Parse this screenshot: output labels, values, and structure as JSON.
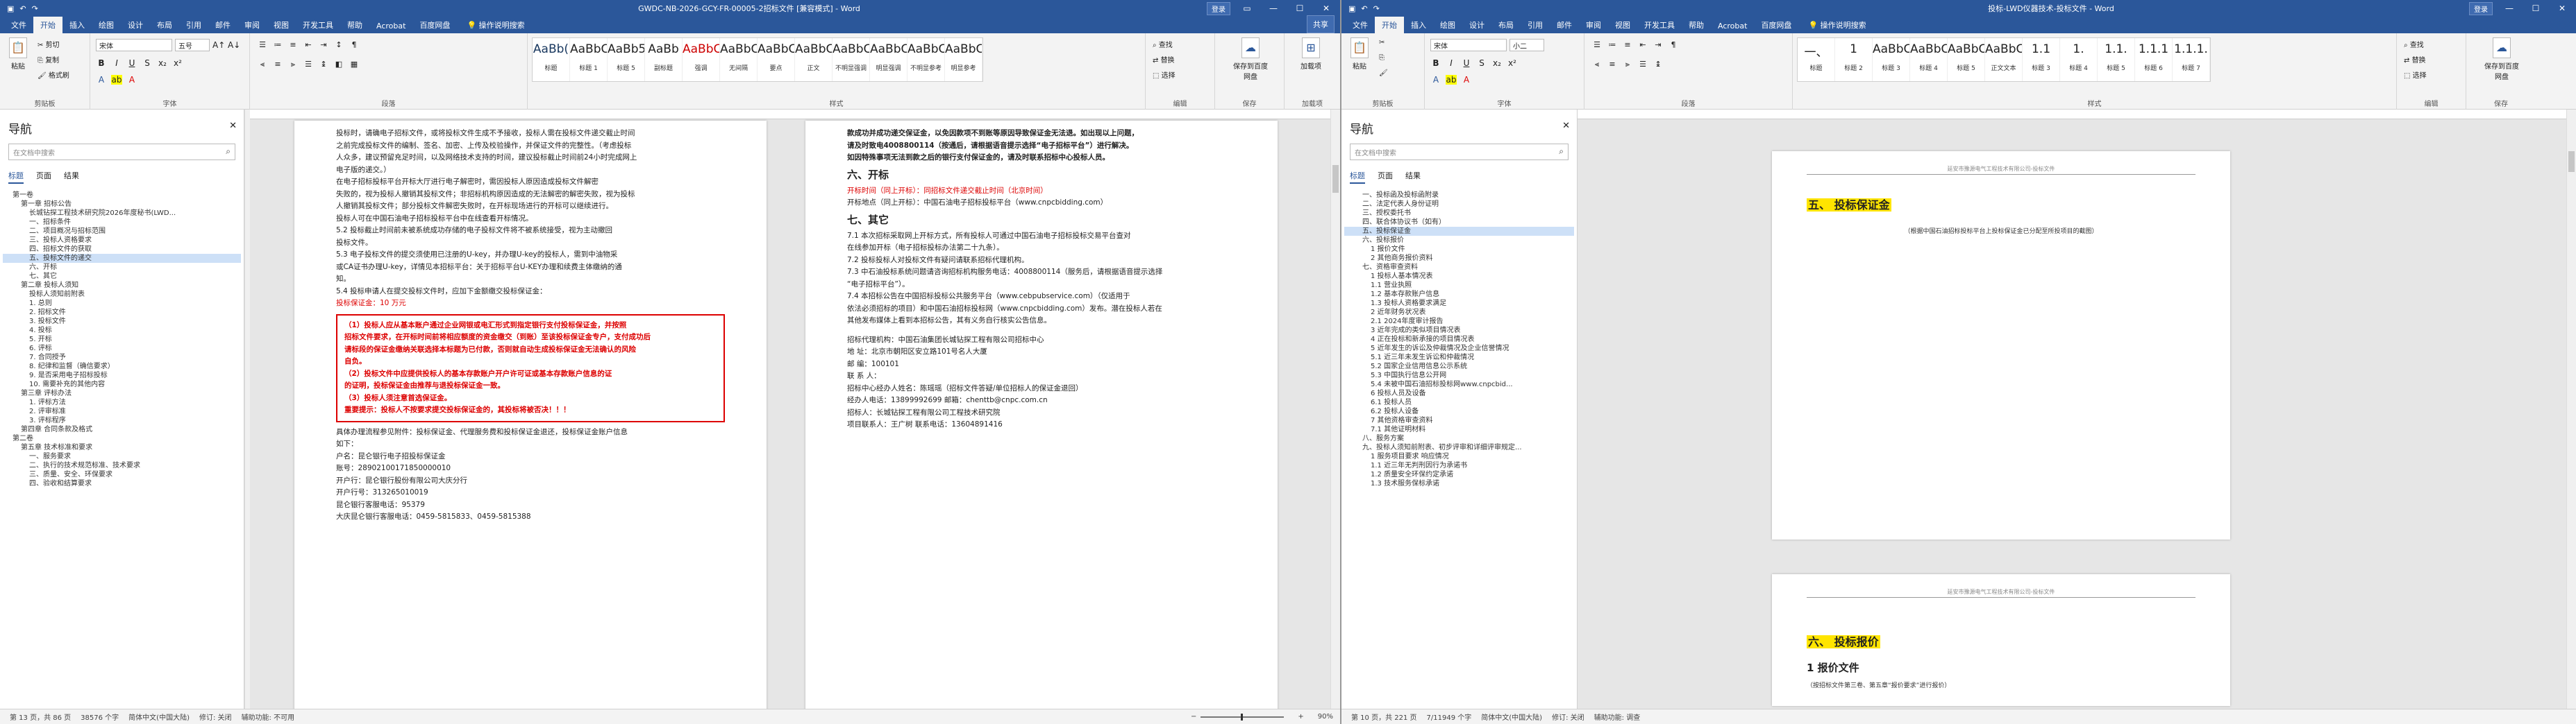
{
  "w1": {
    "title": "GWDC-NB-2026-GCY-FR-00005-2招标文件 [兼容模式] - Word",
    "title_buttons": {
      "login": "登录",
      "share": "共享"
    },
    "qat": [
      "保存",
      "撤销",
      "恢复"
    ],
    "tabs": [
      "文件",
      "开始",
      "插入",
      "绘图",
      "设计",
      "布局",
      "引用",
      "邮件",
      "审阅",
      "视图",
      "开发工具",
      "帮助",
      "Acrobat",
      "百度网盘"
    ],
    "tell_me": "操作说明搜索",
    "ribbon": {
      "clipboard": {
        "label": "剪贴板",
        "paste": "粘贴",
        "cut": "剪切",
        "copy": "复制",
        "painter": "格式刷"
      },
      "font": {
        "label": "字体",
        "name": "宋体",
        "size": "五号"
      },
      "paragraph": {
        "label": "段落"
      },
      "styles": {
        "label": "样式",
        "items": [
          {
            "p": "AaBb(",
            "n": "标题"
          },
          {
            "p": "AaBbCcI",
            "n": "标题 1"
          },
          {
            "p": "AaBb5",
            "n": "标题 5"
          },
          {
            "p": "AaBb",
            "n": "副标题"
          },
          {
            "p": "AaBbCcDd",
            "n": "强调"
          },
          {
            "p": "AaBbCcDd",
            "n": "无间隔"
          },
          {
            "p": "AaBbCcDd",
            "n": "要点"
          },
          {
            "p": "AaBbCcDc",
            "n": "正文"
          },
          {
            "p": "AaBbCcDd",
            "n": "不明显强调"
          },
          {
            "p": "AaBbCcDd",
            "n": "明显强调"
          },
          {
            "p": "AaBbCcDd",
            "n": "不明显参考"
          },
          {
            "p": "AaBbCcDd",
            "n": "明显参考"
          }
        ]
      },
      "editing": {
        "label": "编辑",
        "find": "查找",
        "replace": "替换",
        "select": "选择"
      },
      "save_baidu": {
        "label": "保存",
        "text": "保存到百度网盘"
      },
      "addin": {
        "label": "加载项",
        "text": "加载项"
      }
    },
    "nav": {
      "title": "导航",
      "search_placeholder": "在文档中搜索",
      "tabs": [
        "标题",
        "页面",
        "结果"
      ],
      "items": [
        "第一卷",
        "第一章  招标公告",
        "长城钻探工程技术研究院2026年度秘书(LWD...",
        "一、招标条件",
        "二、项目概况与招标范围",
        "三、投标人资格要求",
        "四、招标文件的获取",
        "五、投标文件的递交",
        "六、开标",
        "七、其它",
        "第二章  投标人须知",
        "投标人须知前附表",
        "1. 总则",
        "2. 招标文件",
        "3. 投标文件",
        "4. 投标",
        "5. 开标",
        "6. 评标",
        "7. 合同授予",
        "8. 纪律和监督（确信要求）",
        "9. 是否采用电子招标投标",
        "10. 需要补充的其他内容",
        "第三章  评标办法",
        "1. 评标方法",
        "2. 评审标准",
        "3. 评标程序",
        "第四章  合同条款及格式",
        "第二卷",
        "第五章  技术标准和要求",
        "一、服务要求",
        "二、执行的技术规范标准、技术要求",
        "三、质量、安全、环保要求",
        "四、验收和结算要求"
      ],
      "highlight_index": 7
    },
    "page_left": {
      "lines": [
        "投标时，请确电子招标文件，或将投标文件生成不予接收，投标人需在投标文件递交截止时间",
        "之前完成投标文件的编制、签名、加密、上传及校验操作，并保证文件的完整性。（考虑投标",
        "人众多，建议预留充足时间，以及网络技术支持的时间，建议投标截止时间前24小时完成网上",
        "电子版的递交。）",
        "    在电子招标投标平台开标大厅进行电子解密时，需因投标人原因造成投标文件解密",
        "失败的，视为投标人撤销其投标文件；非招标机构原因造成的无法解密的解密失败，视为投标",
        "人撤销其投标文件；部分投标文件解密失败时，在开标现场进行的开标可以继续进行。",
        "    投标人可在中国石油电子招标投标平台中在线查看开标情况。",
        "    5.2 投标截止时间前未被系统成功存储的电子投标文件将不被系统接受，视为主动撤回",
        "投标文件。",
        "    5.3 电子投标文件的提交须使用已注册的U-key，并办理U-key的投标人，需到中油物采",
        "或CA证书办理U-key，详情见本招标平台：关于招标平台U-KEY办理和续费主体缴纳的通",
        "知。",
        "    5.4 投标申请人在提交投标文件时，应加下金额缴交投标保证金：",
        "    投标保证金：10 万元"
      ],
      "redbox": [
        "（1）投标人应从基本账户通过企业网银或电汇形式到指定银行支付投标保证金，并按照",
        "招标文件要求，在开标时间前将相应额度的资金缴交（到账）至该投标保证金专户，支付成功后",
        "请标段的保证金缴纳关联选择本标题为已付款，否则就自动生成投标保证金无法确认的风险",
        "自负。",
        "（2）投标文件中应提供投标人的基本存款账户开户许可证或基本存款账户信息的证",
        "的证明，投标保证金由推荐与退投标保证金一致。",
        "（3）投标人须注意首选保证金。",
        "重要提示：投标人不按要求提交投标保证金的，其投标将被否决！！！"
      ],
      "after": [
        "具体办理流程参见附件：投标保证金、代理服务费和投标保证金退还，投标保证金账户信息",
        "如下：",
        "    户名：昆仑银行电子招投标保证金",
        "    账号：28902100171850000010",
        "    开户行：昆仑银行股份有限公司大庆分行",
        "    开户行号：313265010019",
        "    昆仑银行客服电话：95379",
        "    大庆昆仑银行客服电话：0459-5815833、0459-5815388"
      ]
    },
    "page_right": {
      "top": [
        "款成功并成功递交保证金，以免因款项不到账等原因导致保证金无法退。如出现以上问题，",
        "请及时致电4008800114（按通后，请根据语音提示选择“电子招标平台”）进行解决。",
        "    如因特殊事项无法到款之后的银行支付保证金的，请及时联系招标中心投标人员。"
      ],
      "sec6": "六、开标",
      "sec6_lines": [
        "    开标时间（同上开标）：同招标文件递交截止时间（北京时间）",
        "    开标地点（同上开标）：中国石油电子招标投标平台（www.cnpcbidding.com）"
      ],
      "sec7": "七、其它",
      "sec7_lines": [
        "    7.1 本次招标采取网上开标方式，所有投标人可通过中国石油电子招标投标交易平台查对",
        "在线参加开标（电子招标投标办法第二十九条）。",
        "    7.2 投标投标人对投标文件有疑问请联系招标代理机构。",
        "    7.3 中石油投标系统问题请咨询招标机构服务电话：4008800114（服务后，请根据语音提示选择",
        "“电子招标平台”）。",
        "    7.4 本招标公告在中国招标投标公共服务平台（www.cebpubservice.com）（仅适用于",
        "依法必须招标的项目）和中国石油招标投标网（www.cnpcbidding.com）发布。潜在投标人若在",
        "其他发布媒体上看到本招标公告，其有义务自行核实公告信息。"
      ],
      "contact": [
        "    招标代理机构：中国石油集团长城钻探工程有限公司招标中心",
        "    地    址：北京市朝阳区安立路101号名人大厦",
        "    邮    编：100101",
        "    联  系  人：",
        "    招标中心经办人姓名：陈瑶瑶（招标文件答疑/单位招标人的保证金退回）",
        "    经办人电话：13899992699    邮箱：chenttb@cnpc.com.cn",
        "    招标人：长城钻探工程有限公司工程技术研究院",
        "    项目联系人：王广树      联系电话：13604891416"
      ]
    },
    "status": {
      "page": "第 13 页，共 86 页",
      "words": "38576 个字",
      "lang": "简体中文(中国大陆)",
      "track": "修订: 关闭",
      "access": "辅助功能: 不可用",
      "zoom": "90%"
    }
  },
  "w2": {
    "title": "投标-LWD仪器技术-投标文件 - Word",
    "title_buttons": {
      "login": "登录"
    },
    "tabs": [
      "文件",
      "开始",
      "插入",
      "绘图",
      "设计",
      "布局",
      "引用",
      "邮件",
      "审阅",
      "视图",
      "开发工具",
      "帮助",
      "Acrobat",
      "百度网盘"
    ],
    "tell_me": "操作说明搜索",
    "ribbon": {
      "font": {
        "name": "宋体",
        "size": "小二"
      },
      "styles": {
        "items": [
          {
            "p": "一、",
            "n": "标题"
          },
          {
            "p": "1",
            "n": "标题 2"
          },
          {
            "p": "AaBbCcDo",
            "n": "标题 3"
          },
          {
            "p": "AaBbCcI",
            "n": "标题 4"
          },
          {
            "p": "AaBbCcI",
            "n": "标题 5"
          },
          {
            "p": "AaBbCcDd",
            "n": "正文文本"
          },
          {
            "p": "1.1",
            "n": "标题 3"
          },
          {
            "p": "1.",
            "n": "标题 4"
          },
          {
            "p": "1.1.",
            "n": "标题 5"
          },
          {
            "p": "1.1.1",
            "n": "标题 6"
          },
          {
            "p": "1.1.1.",
            "n": "标题 7"
          }
        ]
      },
      "editing": {
        "find": "查找",
        "replace": "替换",
        "select": "选择"
      },
      "save_baidu": {
        "text": "保存到百度网盘"
      }
    },
    "nav": {
      "title": "导航",
      "search_placeholder": "在文档中搜索",
      "tabs": [
        "标题",
        "页面",
        "结果"
      ],
      "items": [
        "一、投标函及投标函附录",
        "二、法定代表人身份证明",
        "三、授权委托书",
        "四、联合体协议书（如有）",
        "五、投标保证金",
        "六、投标报价",
        "1 报价文件",
        "2 其他商务报价资料",
        "七、资格审查资料",
        "1 投标人基本情况表",
        "1.1 营业执照",
        "1.2 基本存款账户信息",
        "1.3 投标人资格要求满足",
        "2 近年财务状况表",
        "2.1 2024年度审计报告",
        "3 近年完成的类似项目情况表",
        "4 正在投标和新承接的项目情况表",
        "5 近年发生的诉讼及仲裁情况及企业信誉情况",
        "5.1 近三年未发生诉讼和仲裁情况",
        "5.2 国家企业信用信息公示系统",
        "5.3 中国执行信息公开网",
        "5.4 未被中国石油招标投标网www.cnpcbid...",
        "6 投标人员及设备",
        "6.1 投标人员",
        "6.2 投标人设备",
        "7 其他资格审查资料",
        "7.1 其他证明材料",
        "八、服务方案",
        "九、投标人须知前附表、初步评审和详细评审规定...",
        "1 服务项目要求 响应情况",
        "1.1 近三年无判刑因行为承诺书",
        "1.2 质量安全环保约定承诺",
        "1.3 技术服务保标承诺"
      ],
      "highlight_index": 4
    },
    "page1": {
      "header": "延安市豫源电气工程技术有限公司-投标文件",
      "heading": "五、 投标保证金",
      "note": "（根据中国石油招标投标平台上投标保证金已分配至所投项目的截图）"
    },
    "page2": {
      "header": "延安市豫源电气工程技术有限公司-投标文件",
      "heading": "六、 投标报价",
      "sub": "1   报价文件",
      "note": "（按招标文件第三卷、第五章“报价要求”进行报价）"
    },
    "status": {
      "page": "第 10 页，共 221 页",
      "words": "7/11949 个字",
      "lang": "简体中文(中国大陆)",
      "track": "修订: 关闭",
      "access": "辅助功能: 调查"
    }
  }
}
